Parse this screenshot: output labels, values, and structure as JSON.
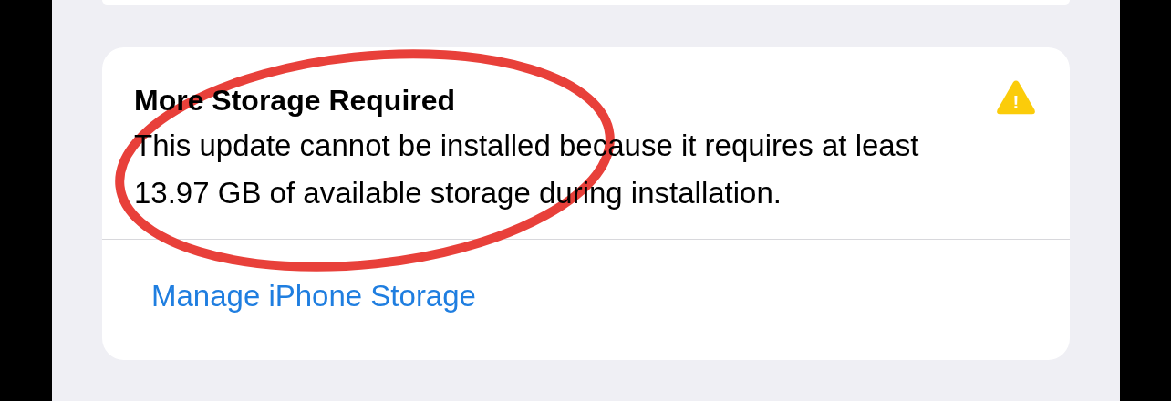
{
  "alert": {
    "title": "More Storage Required",
    "message": "This update cannot be installed because it requires at least 13.97 GB of available storage during installation.",
    "warning_icon": "!",
    "link": "Manage iPhone Storage"
  },
  "annotation": {
    "kind": "ellipse",
    "color": "#e8403a"
  }
}
